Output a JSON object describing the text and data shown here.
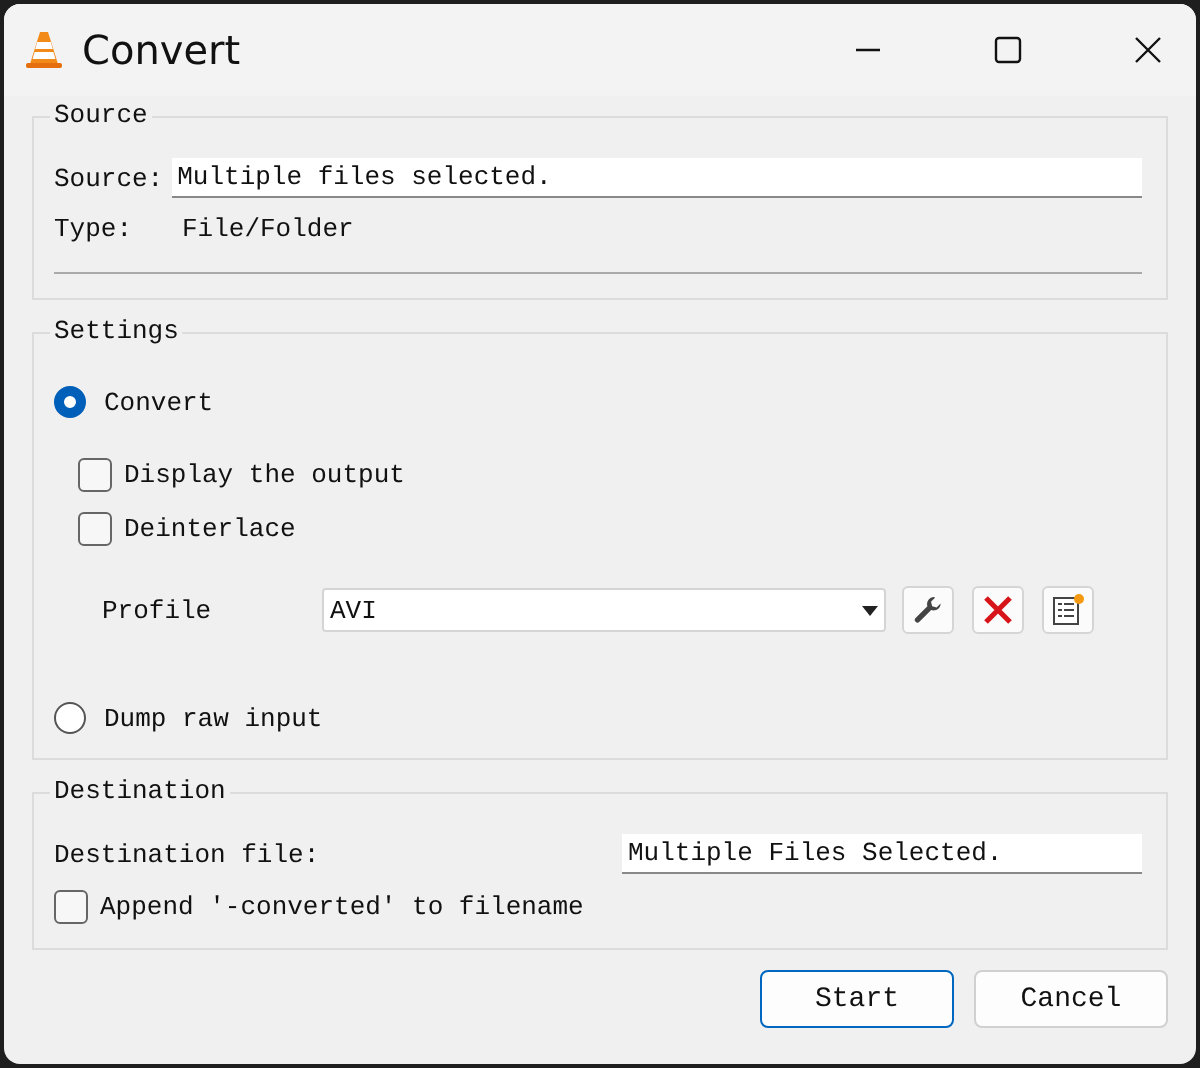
{
  "window": {
    "title": "Convert"
  },
  "source": {
    "title": "Source",
    "source_label": "Source:",
    "source_value": "Multiple files selected.",
    "type_label": "Type:",
    "type_value": "File/Folder"
  },
  "settings": {
    "title": "Settings",
    "modes": [
      {
        "label": "Convert",
        "selected": true
      },
      {
        "label": "Dump raw input",
        "selected": false
      }
    ],
    "checkboxes": [
      {
        "label": "Display the output",
        "checked": false
      },
      {
        "label": "Deinterlace",
        "checked": false
      }
    ],
    "profile": {
      "label": "Profile",
      "value": "AVI"
    }
  },
  "destination": {
    "title": "Destination",
    "file_label": "Destination file:",
    "file_value": "Multiple Files Selected.",
    "append": {
      "label": "Append '-converted' to filename",
      "checked": false
    }
  },
  "buttons": [
    {
      "label": "Start",
      "focused": true
    },
    {
      "label": "Cancel",
      "focused": false
    }
  ]
}
